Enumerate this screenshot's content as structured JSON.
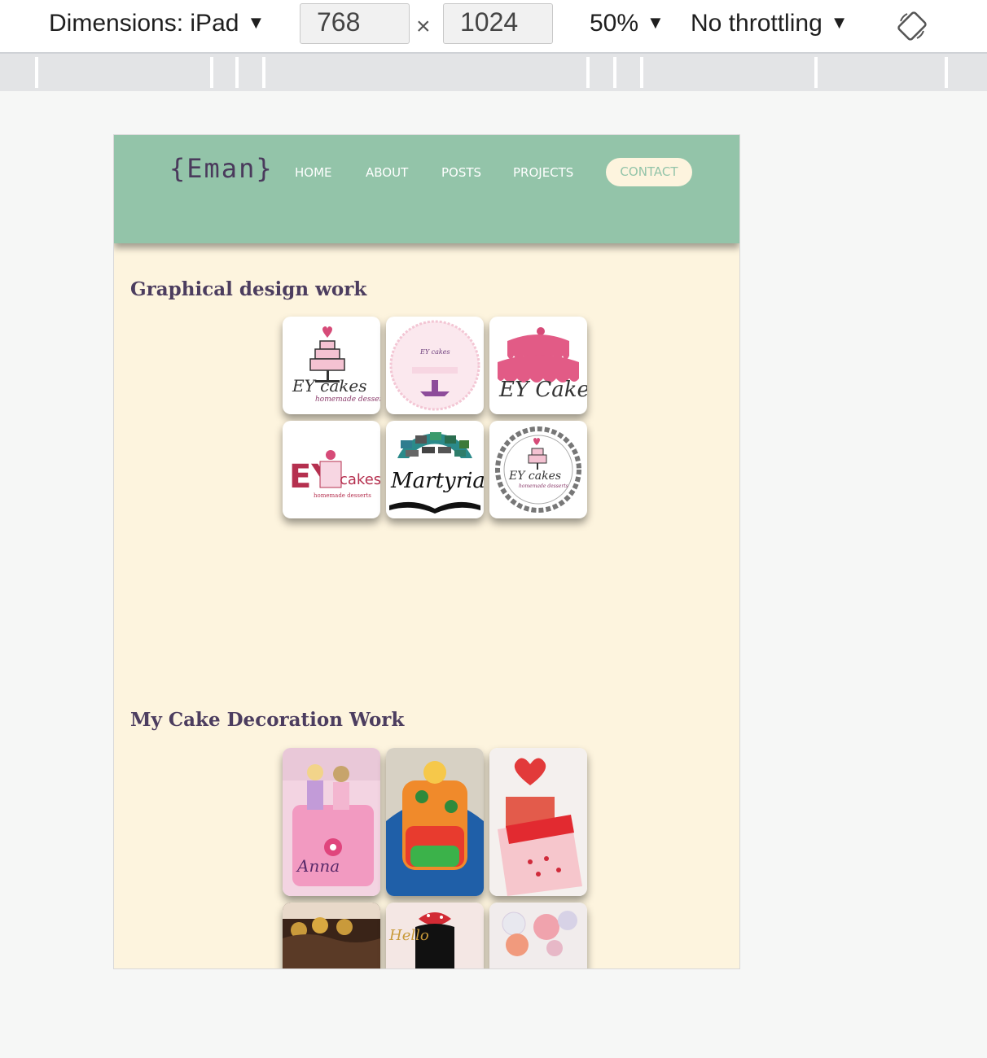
{
  "devtools": {
    "dimensions_label": "Dimensions: iPad",
    "width": "768",
    "height": "1024",
    "times": "×",
    "zoom": "50%",
    "throttling": "No throttling",
    "dropdown_arrow": "▼"
  },
  "site": {
    "logo": "{Eman}",
    "nav": [
      "HOME",
      "ABOUT",
      "POSTS",
      "PROJECTS"
    ],
    "contact": "CONTACT",
    "colors": {
      "header": "#93c4a9",
      "page_bg": "#fdf4de",
      "heading": "#4c3d5f"
    }
  },
  "sections": {
    "graphic_design": {
      "title": "Graphical design work",
      "tiles": [
        {
          "icon": "ey-cakes-logo-icon",
          "text": "EY cakes",
          "sub": "homemade desserts"
        },
        {
          "icon": "ey-cakes-round-logo-icon",
          "text": "EY cakes",
          "sub": ""
        },
        {
          "icon": "ey-cakes-drip-logo-icon",
          "text": "EY Cakes",
          "sub": ""
        },
        {
          "icon": "ey-cakes-pink-logo-icon",
          "text": "EY",
          "text2": "cakes",
          "sub": "homemade desserts"
        },
        {
          "icon": "martyria-logo-icon",
          "text": "Martyria",
          "sub": ""
        },
        {
          "icon": "ey-cakes-badge-logo-icon",
          "text": "EY cakes",
          "sub": "homemade desserts"
        }
      ]
    },
    "cake_decoration": {
      "title": "My Cake Decoration Work",
      "tiles": [
        {
          "icon": "princess-cake-photo-icon",
          "text": "Anna"
        },
        {
          "icon": "tropical-cake-photo-icon",
          "text": ""
        },
        {
          "icon": "heart-cake-photo-icon",
          "text": ""
        },
        {
          "icon": "chocolate-cake-photo-icon",
          "text": ""
        },
        {
          "icon": "minnie-cake-photo-icon",
          "text": "Hello"
        },
        {
          "icon": "balloon-cake-photo-icon",
          "text": ""
        }
      ]
    }
  }
}
